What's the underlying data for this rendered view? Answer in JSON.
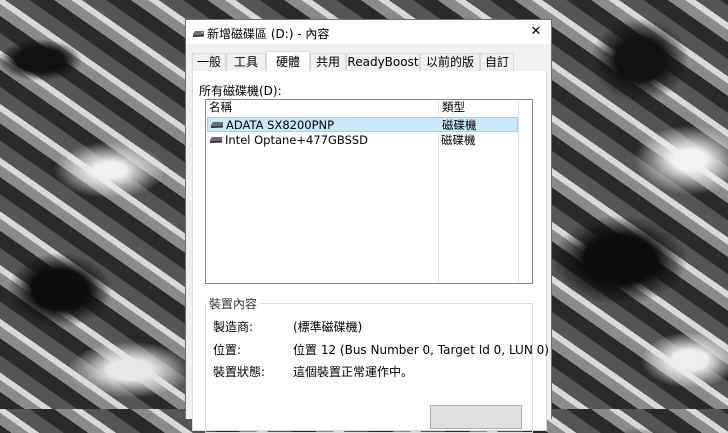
{
  "window": {
    "title": "新增磁碟區 (D:) - 內容",
    "close_glyph": "✕"
  },
  "tabs": [
    {
      "label": "一般"
    },
    {
      "label": "工具"
    },
    {
      "label": "硬體"
    },
    {
      "label": "共用"
    },
    {
      "label": "ReadyBoost"
    },
    {
      "label": "以前的版本"
    },
    {
      "label": "自訂"
    }
  ],
  "active_tab": "硬體",
  "hardware": {
    "all_disks_label": "所有磁碟機(D):",
    "columns": {
      "name": "名稱",
      "type": "類型"
    },
    "rows": [
      {
        "name": "ADATA SX8200PNP",
        "type": "磁碟機",
        "icon": "disk-drive-icon",
        "selected": true
      },
      {
        "name": "Intel Optane+477GBSSD",
        "type": "磁碟機",
        "icon": "disk-drive-icon",
        "selected": false
      }
    ],
    "device_properties": {
      "title": "裝置內容",
      "manufacturer_label": "製造商:",
      "manufacturer_value": "(標準磁碟機)",
      "location_label": "位置:",
      "location_value": "位置 12 (Bus Number 0, Target Id 0, LUN 0)",
      "status_label": "裝置狀態:",
      "status_value": "這個裝置正常運作中。"
    }
  },
  "colors": {
    "selection_bg": "#cce8ff",
    "selection_border": "#99d1ff",
    "window_bg": "#f0f0f0"
  }
}
